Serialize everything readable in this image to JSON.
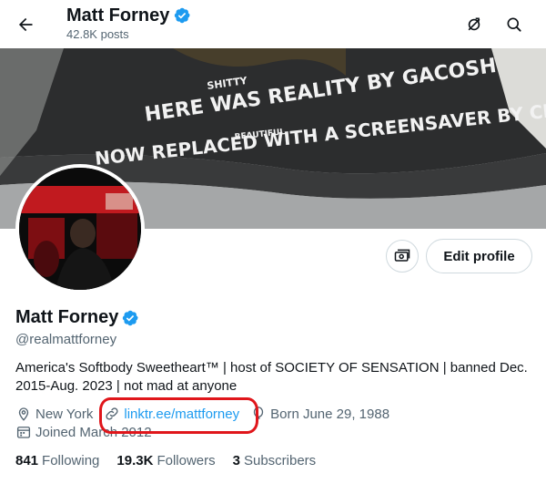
{
  "header": {
    "name": "Matt Forney",
    "posts_count": "42.8K posts",
    "back_icon": "arrow-left-icon",
    "right_icons": [
      "premium-slash-icon",
      "search-icon"
    ]
  },
  "banner": {
    "text_line1": "HERE WAS REALITY BY GACOSH",
    "text_line1_insert": "SHITTY",
    "text_line2": "NOW REPLACED WITH A SCREENSAVER BY CITY HALL",
    "text_line2_insert": "BEAUTIFUL"
  },
  "actions": {
    "edit_profile": "Edit profile",
    "subscribe_icon": "money-icon"
  },
  "profile": {
    "name": "Matt Forney",
    "handle": "@realmattforney",
    "verified_color": "#1d9bf0",
    "bio": "America's Softbody Sweetheart™ | host of SOCIETY OF SENSATION | banned Dec. 2015-Aug. 2023 | not mad at anyone",
    "location": "New York",
    "website": "linktr.ee/mattforney",
    "birthday": "Born June 29, 1988",
    "joined": "Joined March 2012"
  },
  "stats": {
    "following_count": "841",
    "following_label": "Following",
    "followers_count": "19.3K",
    "followers_label": "Followers",
    "subscribers_count": "3",
    "subscribers_label": "Subscribers"
  },
  "colors": {
    "accent": "#1d9bf0",
    "highlight": "#e0161b",
    "secondary_text": "#536471"
  }
}
